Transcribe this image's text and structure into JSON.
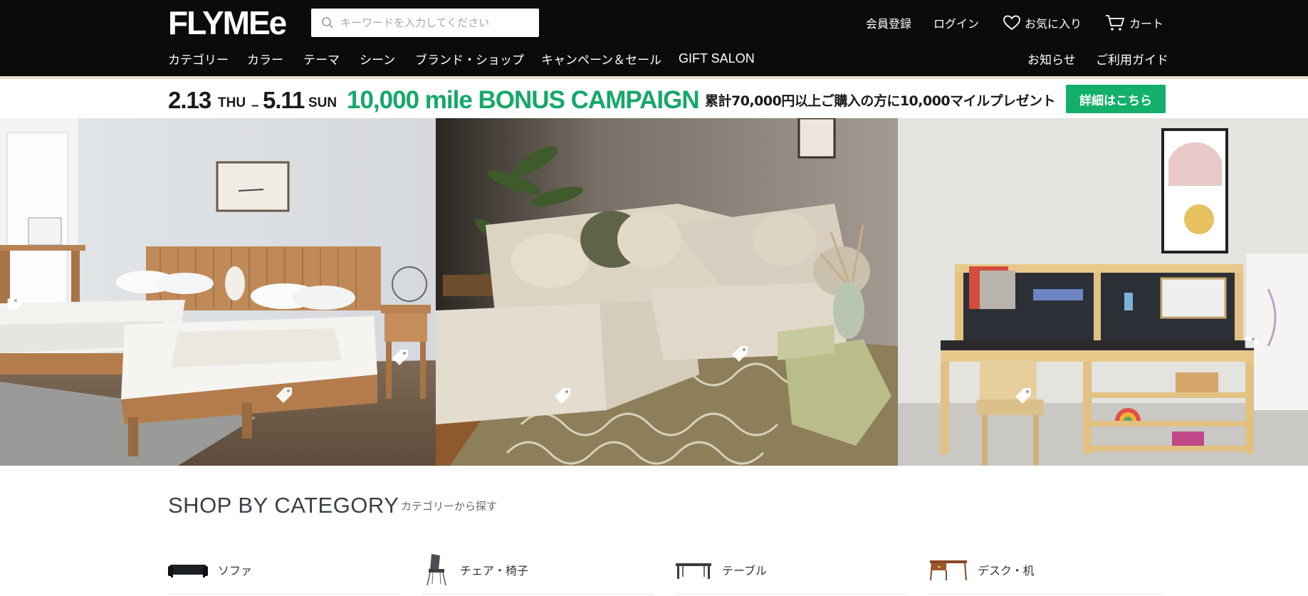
{
  "header": {
    "logo": "FLYMEe",
    "search": {
      "placeholder": "キーワードを入力してください",
      "value": ""
    },
    "utility": {
      "register": "会員登録",
      "login": "ログイン",
      "favorites": "お気に入り",
      "cart": "カート"
    },
    "nav": [
      "カテゴリー",
      "カラー",
      "テーマ",
      "シーン",
      "ブランド・ショップ",
      "キャンペーン＆セール",
      "GIFT SALON"
    ],
    "nav_right": [
      "お知らせ",
      "ご利用ガイド"
    ]
  },
  "banner": {
    "start_date": "2.13",
    "start_day": "THU",
    "separator": "–",
    "end_date": "5.11",
    "end_day": "SUN",
    "campaign": "10,000 mile BONUS CAMPAIGN",
    "description": "累計70,000円以上ご購入の方に10,000マイルプレゼント",
    "button": "詳細はこちら"
  },
  "hero": {
    "panels": [
      {
        "scene": "bedroom",
        "icon": "bed-room-photo"
      },
      {
        "scene": "living-room",
        "icon": "sofa-room-photo"
      },
      {
        "scene": "kids-room",
        "icon": "kids-desk-photo"
      }
    ]
  },
  "category": {
    "title": "SHOP BY CATEGORY",
    "subtitle": "カテゴリーから探す",
    "items": [
      {
        "label": "ソファ",
        "icon": "sofa-icon"
      },
      {
        "label": "チェア・椅子",
        "icon": "chair-icon"
      },
      {
        "label": "テーブル",
        "icon": "table-icon"
      },
      {
        "label": "デスク・机",
        "icon": "desk-icon"
      }
    ]
  },
  "colors": {
    "header_bg": "#0b0b0b",
    "accent_green": "#16a86a",
    "button_green": "#12b06a"
  }
}
